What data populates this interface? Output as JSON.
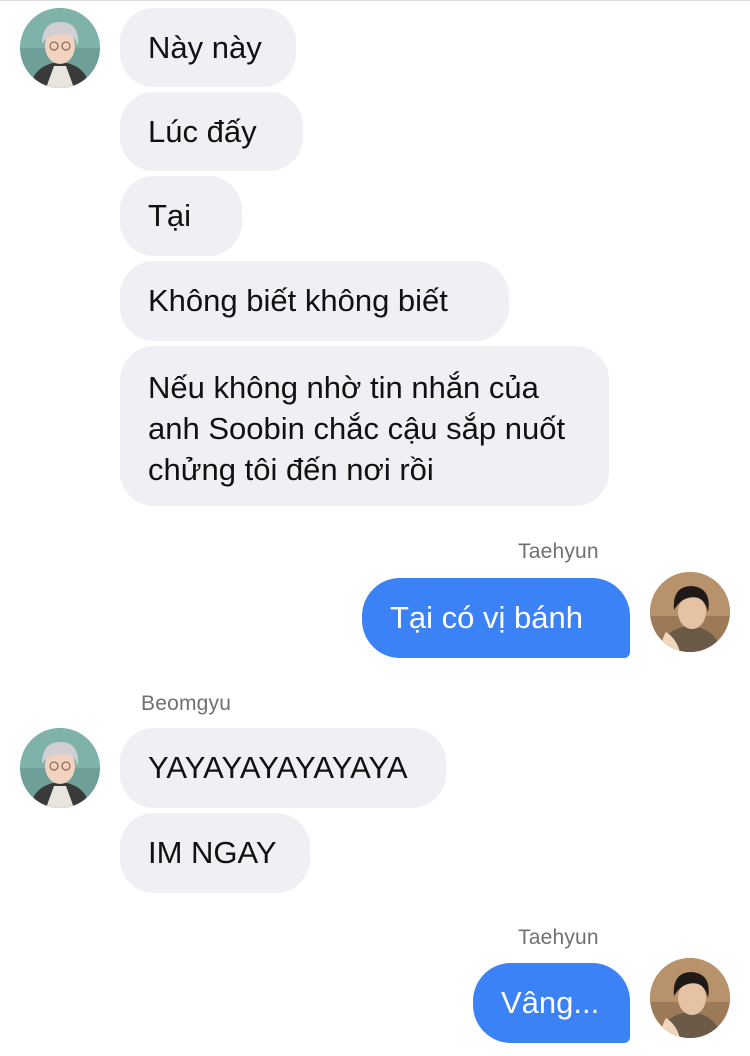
{
  "contacts": {
    "beomgyu": {
      "name": "Beomgyu",
      "avatar_icon": "beomgyu-avatar-photo"
    },
    "taehyun": {
      "name": "Taehyun",
      "avatar_icon": "taehyun-avatar-photo"
    }
  },
  "colors": {
    "incoming_bubble": "#efeff4",
    "outgoing_bubble": "#3b82f6",
    "sender_label": "#707070"
  },
  "messages": [
    {
      "text": "Này này"
    },
    {
      "text": "Lúc đấy"
    },
    {
      "text": "Tại"
    },
    {
      "text": "Không biết không biết"
    },
    {
      "text": "Nếu không nhờ tin nhắn của anh Soobin chắc cậu sắp nuốt chửng tôi đến nơi rồi"
    },
    {
      "sender": "Taehyun",
      "text": "Tại có vị bánh"
    },
    {
      "sender": "Beomgyu",
      "text": "YAYAYAYAYAYAYA"
    },
    {
      "text": "IM NGAY"
    },
    {
      "sender": "Taehyun",
      "text": "Vâng..."
    }
  ]
}
